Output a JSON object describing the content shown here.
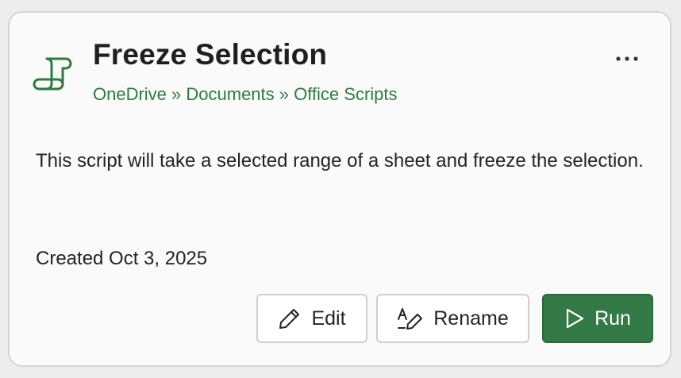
{
  "card": {
    "title": "Freeze Selection",
    "breadcrumb": "OneDrive » Documents » Office Scripts",
    "description": "This script will take a selected range of a sheet and freeze the selection.",
    "created": "Created Oct 3, 2025"
  },
  "actions": {
    "edit_label": "Edit",
    "rename_label": "Rename",
    "run_label": "Run"
  },
  "icons": {
    "script": "script-scroll-icon",
    "more": "more-horizontal-icon",
    "edit": "pencil-icon",
    "rename": "rename-text-icon",
    "run": "play-icon"
  },
  "colors": {
    "accent": "#2f7a3e",
    "primary_button": "#347a46",
    "card_background": "#fafafa",
    "page_background": "#ededed"
  }
}
